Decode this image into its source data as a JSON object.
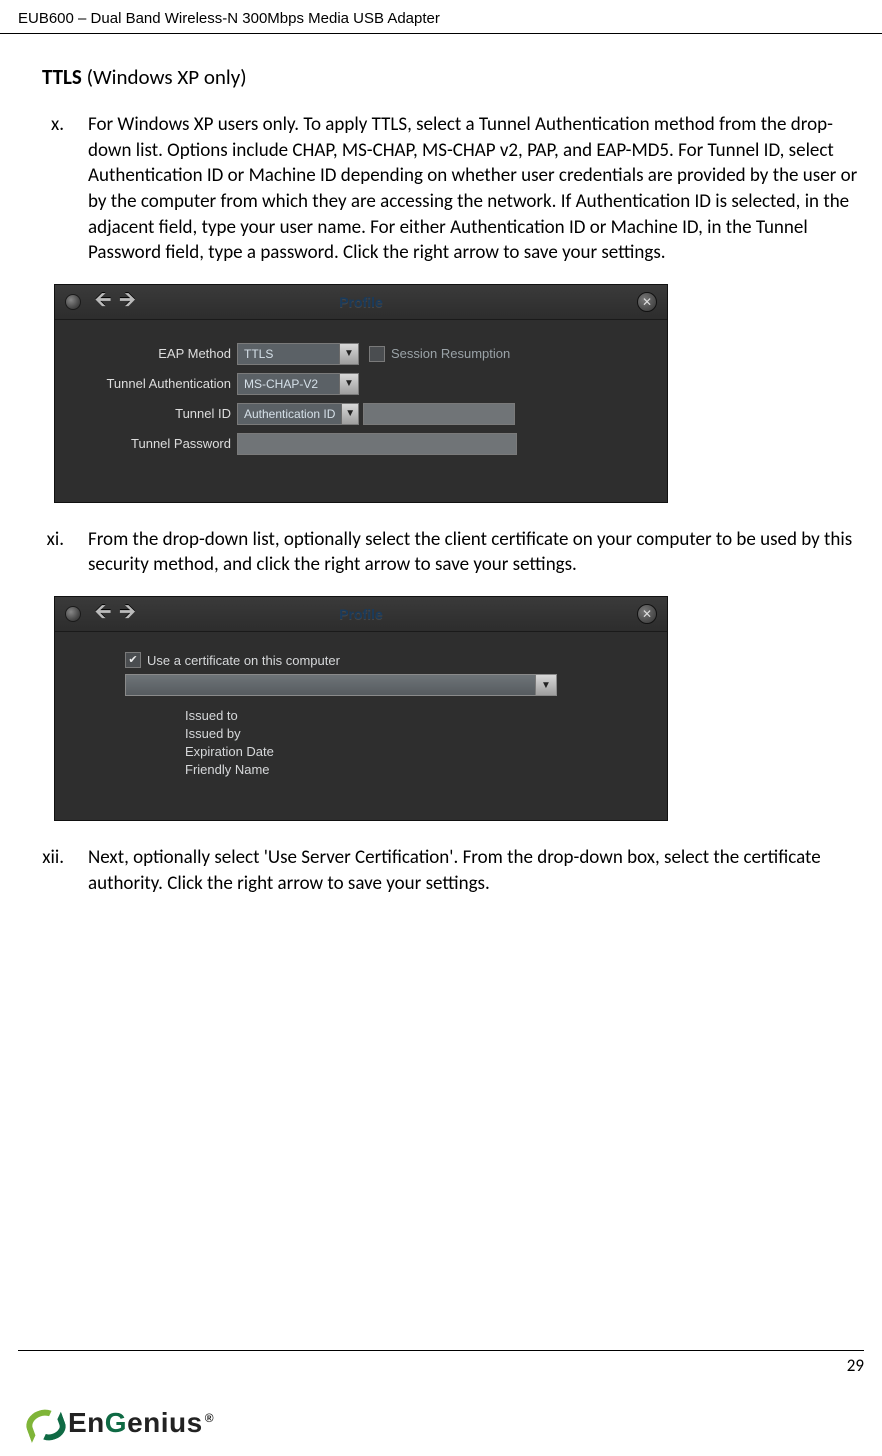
{
  "header": {
    "product": "EUB600 – Dual Band Wireless-N 300Mbps Media USB Adapter"
  },
  "section": {
    "title_bold": "TTLS",
    "title_rest": " (Windows XP only)"
  },
  "items": {
    "x": {
      "marker": "x.",
      "text": "For Windows XP users only. To apply TTLS, select a Tunnel Authentication method from the drop-down list. Options include CHAP, MS-CHAP, MS-CHAP v2, PAP, and EAP-MD5. For Tunnel ID, select Authentication ID or Machine ID depending on whether user credentials are provided by the user or by the computer from which they are accessing the network. If Authentication ID is selected, in the adjacent field, type your user name. For either Authentication ID or Machine ID, in the Tunnel Password field, type a password. Click the right arrow to save your settings."
    },
    "xi": {
      "marker": "xi.",
      "text": "From the drop-down list, optionally select the client certificate on your computer to be used by this security method, and click the right arrow to save your settings."
    },
    "xii": {
      "marker": "xii.",
      "text": "Next, optionally select 'Use Server Certification'. From the drop-down box, select the certificate authority. Click the right arrow to save your settings."
    }
  },
  "dialog1": {
    "title": "Profile",
    "eap_label": "EAP Method",
    "eap_value": "TTLS",
    "session_label": "Session Resumption",
    "tauth_label": "Tunnel Authentication",
    "tauth_value": "MS-CHAP-V2",
    "tid_label": "Tunnel ID",
    "tid_value": "Authentication ID",
    "tpwd_label": "Tunnel Password"
  },
  "dialog2": {
    "title": "Profile",
    "use_cert": "Use a certificate on this computer",
    "issued_to": "Issued to",
    "issued_by": "Issued by",
    "exp_date": "Expiration Date",
    "friendly": "Friendly Name"
  },
  "footer": {
    "page": "29",
    "brand_en": "En",
    "brand_g": "G",
    "brand_rest": "enius",
    "reg": "®"
  }
}
